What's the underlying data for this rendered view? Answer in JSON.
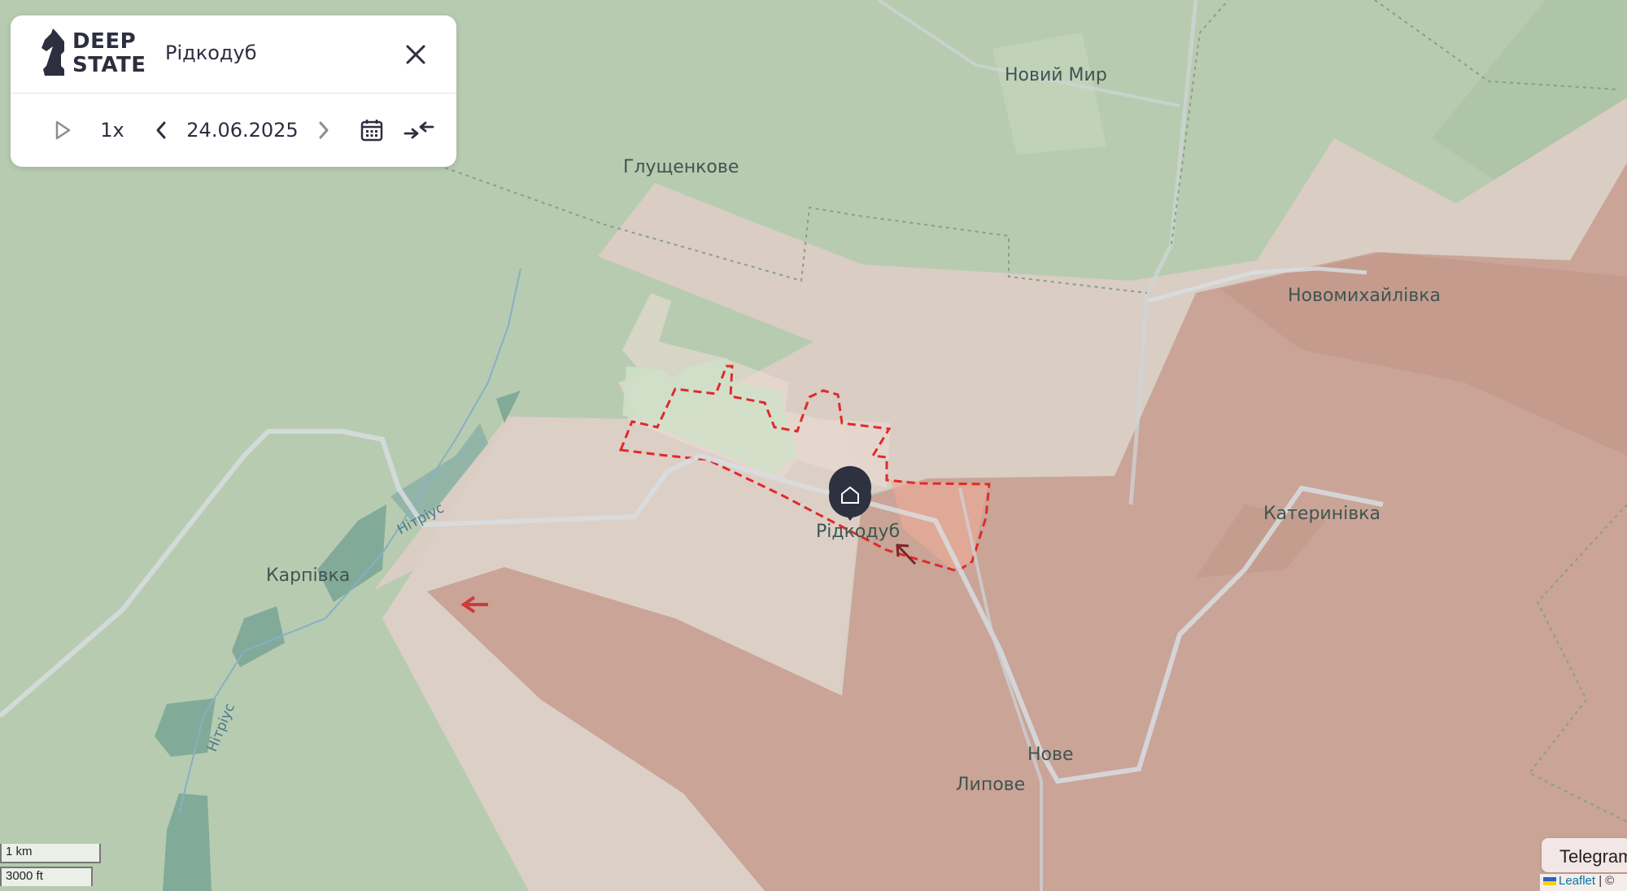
{
  "panel": {
    "logo_line1": "DEEP",
    "logo_line2": "STATE",
    "title": "Рідкодуб",
    "speed": "1x",
    "date": "24.06.2025"
  },
  "map": {
    "places": [
      {
        "label": "Новий Мир"
      },
      {
        "label": "Глущенкове"
      },
      {
        "label": "Новомихайлівка"
      },
      {
        "label": "Катеринівка"
      },
      {
        "label": "Карпівка"
      },
      {
        "label": "Рідкодуб"
      },
      {
        "label": "Нове"
      },
      {
        "label": "Липове"
      }
    ],
    "rivers": [
      {
        "label": "Нітріус"
      },
      {
        "label": "Нітріус"
      }
    ],
    "colors": {
      "liberated": "#b7cbb0",
      "grey_zone": "#d8ccc3",
      "occupied": "#c9a497",
      "contested_outline": "#e02a2a"
    }
  },
  "scale": {
    "metric": "1 km",
    "imperial": "3000 ft"
  },
  "footer": {
    "telegram": "Telegram",
    "leaflet": "Leaflet",
    "separator": "| ©"
  }
}
